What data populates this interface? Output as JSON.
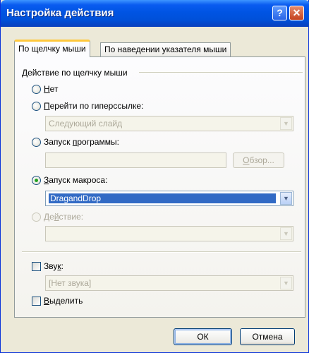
{
  "window": {
    "title": "Настройка действия",
    "help_button": "?",
    "close_button": "✕"
  },
  "tabs": [
    {
      "label": "По щелчку мыши",
      "active": true
    },
    {
      "label": "По наведении указателя мыши",
      "active": false
    }
  ],
  "group": {
    "label": "Действие по щелчку мыши"
  },
  "options": {
    "none": {
      "prefix": "",
      "access": "Н",
      "rest": "ет",
      "checked": false
    },
    "hyperlink": {
      "prefix": "",
      "access": "П",
      "rest": "ерейти по гиперссылке:",
      "checked": false,
      "value": "Следующий слайд"
    },
    "run_program": {
      "prefix": "Запуск ",
      "access": "п",
      "rest": "рограммы:",
      "checked": false,
      "value": "",
      "browse_prefix": "",
      "browse_access": "О",
      "browse_rest": "бзор..."
    },
    "run_macro": {
      "prefix": "",
      "access": "З",
      "rest": "апуск макроса:",
      "checked": true,
      "value": "DragandDrop"
    },
    "object_action": {
      "prefix": "Де",
      "access": "й",
      "rest": "ствие:",
      "checked": false,
      "disabled": true,
      "value": ""
    }
  },
  "sound": {
    "prefix": "Зву",
    "access": "к",
    "rest": ":",
    "checked": false,
    "value": "[Нет звука]"
  },
  "highlight": {
    "prefix": "",
    "access": "В",
    "rest": "ыделить",
    "checked": false
  },
  "buttons": {
    "ok": "ОК",
    "cancel": "Отмена"
  },
  "colors": {
    "titlebar": "#0054e3",
    "dialog_bg": "#ece9d8",
    "selection": "#316ac5",
    "tab_highlight": "#ffc83c"
  }
}
